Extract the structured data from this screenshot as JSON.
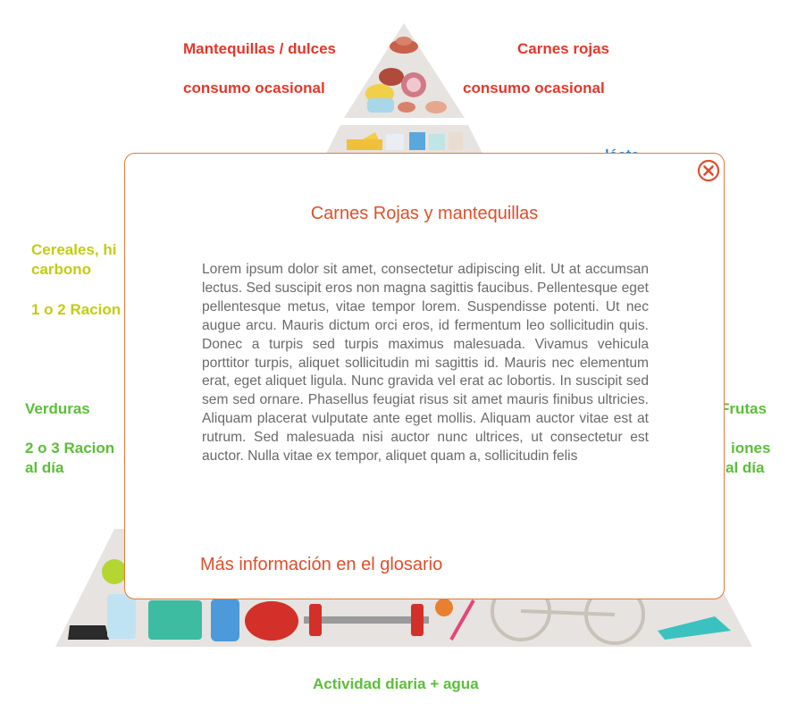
{
  "labels": {
    "top_left_title": "Mantequillas / dulces",
    "top_left_freq": "consumo ocasional",
    "top_right_title": "Carnes rojas",
    "top_right_freq": "consumo ocasional",
    "cereals_title_line1": "Cereales, hi",
    "cereals_title_line2": "carbono",
    "cereals_freq": "1 o 2 Racion",
    "vegetables_title": "Verduras",
    "vegetables_freq_line1": "2 o 3 Racion",
    "vegetables_freq_line2": "al día",
    "fruits_title": "Frutas",
    "fruits_freq_line1": "iones",
    "fruits_freq_line2": "al día",
    "dairy_partial": "lácte",
    "bottom": "Actividad diaria + agua"
  },
  "modal": {
    "title": "Carnes Rojas y mantequillas",
    "body": "Lorem ipsum dolor sit amet, consectetur adipiscing elit. Ut at accumsan lectus. Sed suscipit eros non magna sagittis faucibus. Pellentesque eget pellentesque metus, vitae tempor lorem. Suspendisse potenti. Ut nec augue arcu. Mauris dictum orci eros, id fermentum leo sollicitudin quis. Donec a turpis sed turpis maximus malesuada. Vivamus vehicula porttitor turpis, aliquet sollicitudin mi sagittis id. Mauris nec elementum erat, eget aliquet ligula. Nunc gravida vel erat ac lobortis. In suscipit sed sem sed ornare. Phasellus feugiat risus sit amet mauris finibus ultricies. Aliquam placerat vulputate ante eget mollis. Aliquam auctor vitae est at rutrum. Sed malesuada nisi auctor nunc ultrices, ut consectetur est auctor. Nulla vitae ex tempor, aliquet quam a, sollicitudin felis",
    "link": "Más información en el glosario",
    "close_icon": "close-circle-icon"
  },
  "colors": {
    "red_label": "#e5372a",
    "yellow_label": "#c4cc12",
    "green_label": "#5cbe3a",
    "modal_accent": "#e04e2a",
    "modal_border": "#e07a3c"
  }
}
